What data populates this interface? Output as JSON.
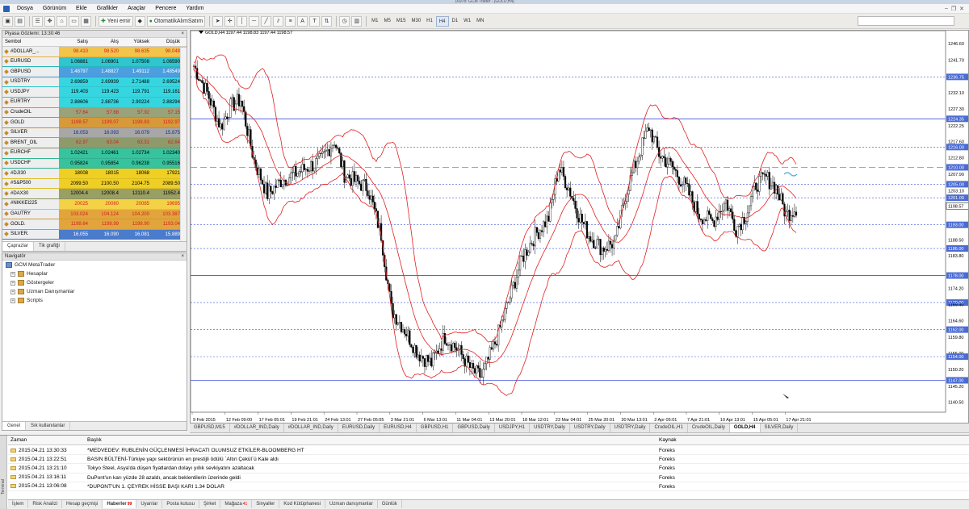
{
  "window": {
    "title": "16978: GCM Trader - [GOLD,H4]"
  },
  "menu": [
    "Dosya",
    "Görünüm",
    "Ekle",
    "Grafikler",
    "Araçlar",
    "Pencere",
    "Yardım"
  ],
  "toolbar": {
    "new_order_label": "Yeni emir",
    "autotrade_label": "OtomatikAlımSatım",
    "timeframes": [
      "M1",
      "M5",
      "M15",
      "M30",
      "H1",
      "H4",
      "D1",
      "W1",
      "MN"
    ],
    "active_timeframe": "H4"
  },
  "market_watch": {
    "title": "Piyasa Gözlemi: 13:30:46",
    "columns": [
      "Sembol",
      "Satış",
      "Alış",
      "Yüksek",
      "Düşük"
    ],
    "rows": [
      {
        "symbol": "#DOLLAR_...",
        "bid": "98.410",
        "ask": "98.520",
        "high": "98.635",
        "low": "98.048",
        "bg": "#f3c44a",
        "fg": "#d21f1f"
      },
      {
        "symbol": "EURUSD",
        "bid": "1.06881",
        "ask": "1.06901",
        "high": "1.07508",
        "low": "1.06590",
        "bg": "#2ec6cf",
        "fg": "#000000"
      },
      {
        "symbol": "GBPUSD",
        "bid": "1.48797",
        "ask": "1.48827",
        "high": "1.49112",
        "low": "1.48549",
        "bg": "#4b9ee0",
        "fg": "#ffffff"
      },
      {
        "symbol": "USDTRY",
        "bid": "2.69859",
        "ask": "2.69939",
        "high": "2.71488",
        "low": "2.69524",
        "bg": "#35d6e0",
        "fg": "#000000"
      },
      {
        "symbol": "USDJPY",
        "bid": "119.403",
        "ask": "119.423",
        "high": "119.791",
        "low": "119.161",
        "bg": "#35d6e0",
        "fg": "#000000"
      },
      {
        "symbol": "EURTRY",
        "bid": "2.88606",
        "ask": "2.88736",
        "high": "2.90224",
        "low": "2.88294",
        "bg": "#35d6e0",
        "fg": "#000000"
      },
      {
        "symbol": "CrudeOIL",
        "bid": "57.64",
        "ask": "57.68",
        "high": "57.92",
        "low": "57.15",
        "bg": "#9aa27a",
        "fg": "#d21f1f"
      },
      {
        "symbol": "GOLD",
        "bid": "1198.57",
        "ask": "1199.07",
        "high": "1198.83",
        "low": "1192.97",
        "bg": "#d79a3b",
        "fg": "#d21f1f"
      },
      {
        "symbol": "SILVER",
        "bid": "16.053",
        "ask": "16.093",
        "high": "16.079",
        "low": "15.875",
        "bg": "#a7a7a7",
        "fg": "#1c2a8c"
      },
      {
        "symbol": "BRENT_OIL",
        "bid": "62.97",
        "ask": "63.04",
        "high": "63.31",
        "low": "62.64",
        "bg": "#8f9a6c",
        "fg": "#d21f1f"
      },
      {
        "symbol": "EURCHF",
        "bid": "1.02421",
        "ask": "1.02461",
        "high": "1.02734",
        "low": "1.02340",
        "bg": "#36c39d",
        "fg": "#000000"
      },
      {
        "symbol": "USDCHF",
        "bid": "0.95824",
        "ask": "0.95854",
        "high": "0.96238",
        "low": "0.95516",
        "bg": "#36c39d",
        "fg": "#000000"
      },
      {
        "symbol": "#DJI30",
        "bid": "18008",
        "ask": "18015",
        "high": "18068",
        "low": "17921",
        "bg": "#f0cf24",
        "fg": "#000000"
      },
      {
        "symbol": "#S&P500",
        "bid": "2099.50",
        "ask": "2100.50",
        "high": "2104.75",
        "low": "2089.50",
        "bg": "#f0cf24",
        "fg": "#000000"
      },
      {
        "symbol": "#DAX30",
        "bid": "12004.4",
        "ask": "12008.4",
        "high": "12110.4",
        "low": "11952.4",
        "bg": "#9a9f63",
        "fg": "#000000"
      },
      {
        "symbol": "#NIKKEI225",
        "bid": "20025",
        "ask": "20060",
        "high": "20085",
        "low": "19695",
        "bg": "#f4d246",
        "fg": "#d21f1f"
      },
      {
        "symbol": "GAUTRY",
        "bid": "103.024",
        "ask": "104.124",
        "high": "104.200",
        "low": "103.387",
        "bg": "#e2a53c",
        "fg": "#d21f1f"
      },
      {
        "symbol": "GOLD.",
        "bid": "1198.64",
        "ask": "1198.99",
        "high": "1198.90",
        "low": "1193.04",
        "bg": "#e2a53c",
        "fg": "#d21f1f"
      },
      {
        "symbol": "SILVER.",
        "bid": "16.055",
        "ask": "16.090",
        "high": "16.081",
        "low": "15.889",
        "bg": "#4b7ccc",
        "fg": "#ffffff"
      }
    ],
    "tabs": [
      "Çaprazlar",
      "Tik grafiği"
    ]
  },
  "navigator": {
    "title": "Navigatör",
    "root": "GCM MetaTrader",
    "items": [
      "Hesaplar",
      "Göstergeler",
      "Uzman Danışmanlar",
      "Scripts"
    ],
    "tabs": [
      "Genel",
      "Sık kullanılanlar"
    ]
  },
  "chart": {
    "info_line": "GOLD,H4  1197.44 1198.83 1197.44 1198.57",
    "price_labels": [
      "1246.60",
      "1241.70",
      "1236.75",
      "1232.10",
      "1227.30",
      "1224.35",
      "1222.25",
      "1217.60",
      "1216.00",
      "1212.80",
      "1210.00",
      "1207.90",
      "1205.00",
      "1203.10",
      "1201.00",
      "1198.57",
      "1193.00",
      "1188.50",
      "1186.00",
      "1183.80",
      "1178.00",
      "1174.20",
      "1170.00",
      "1169.40",
      "1164.60",
      "1162.00",
      "1159.80",
      "1155.00",
      "1154.00",
      "1150.20",
      "1147.00",
      "1145.20",
      "1140.50"
    ],
    "time_labels": [
      "9 Feb 2015",
      "12 Feb 09:00",
      "17 Feb 05:01",
      "19 Feb 21:01",
      "24 Feb 13:01",
      "27 Feb 05:05",
      "3 Mar 21:01",
      "6 Mar 13:01",
      "11 Mar 04:01",
      "13 Mar 20:01",
      "18 Mar 12:01",
      "23 Mar 04:01",
      "25 Mar 20:01",
      "30 Mar 13:01",
      "2 Apr 05:01",
      "7 Apr 21:01",
      "10 Apr 13:01",
      "15 Apr 05:01",
      "17 Apr 21:01"
    ],
    "colors": {
      "candle": "#000000",
      "bands": "#e02020",
      "lines": "#3f51d8",
      "current": "#4a6bd4"
    },
    "tabs": [
      "GBPUSD,M15",
      "#DOLLAR_IND,Daily",
      "#DOLLAR_IND,Daily",
      "EURUSD,Daily",
      "EURUSD,H4",
      "GBPUSD,H1",
      "GBPUSD,Daily",
      "USDJPY,H1",
      "USDTRY,Daily",
      "USDTRY,Daily",
      "USDTRY,Daily",
      "CrudeOIL,H1",
      "CrudeOIL,Daily",
      "GOLD,H4",
      "SILVER,Daily"
    ],
    "active_tab": "GOLD,H4"
  },
  "terminal": {
    "side_label": "Terminal",
    "columns": [
      "Zaman",
      "Başlık",
      "Kaynak"
    ],
    "rows": [
      {
        "time": "2015.04.21 13:30:33",
        "title": "*MEDVEDEV: RUBLENİN GÜÇLENMESİ İHRACATI OLUMSUZ ETKİLER-BLOOMBERG HT",
        "source": "Foreks"
      },
      {
        "time": "2015.04.21 13:22:51",
        "title": "BASIN BÜLTENİ-Türkiye yapı sektörünün en prestijli ödülü `Altın Çekül`ü Kale aldı",
        "source": "Foreks"
      },
      {
        "time": "2015.04.21 13:21:10",
        "title": "Tokyo Steel, Asya'da düşen fiyatlardan dolayı yıllık sevkiyatını azaltacak",
        "source": "Foreks"
      },
      {
        "time": "2015.04.21 13:16:11",
        "title": "DuPont'un karı yüzde 28 azaldı, ancak beklentilerin üzerinde geldi",
        "source": "Foreks"
      },
      {
        "time": "2015.04.21 13:06:08",
        "title": "*DUPONT'UN 1. ÇEYREK HİSSE BAŞI KARI 1.34 DOLAR",
        "source": "Foreks"
      }
    ],
    "tabs": [
      {
        "label": "İşlem",
        "badge": ""
      },
      {
        "label": "Risk Analizi",
        "badge": ""
      },
      {
        "label": "Hesap geçmişi",
        "badge": ""
      },
      {
        "label": "Haberler",
        "badge": "99"
      },
      {
        "label": "Uyarılar",
        "badge": ""
      },
      {
        "label": "Posta kutusu",
        "badge": ""
      },
      {
        "label": "Şirket",
        "badge": ""
      },
      {
        "label": "Mağaza",
        "badge": "41"
      },
      {
        "label": "Sinyaller",
        "badge": ""
      },
      {
        "label": "Kod Kütüphanesi",
        "badge": ""
      },
      {
        "label": "Uzman danışmanlar",
        "badge": ""
      },
      {
        "label": "Günlük",
        "badge": ""
      }
    ],
    "active_tab": "Haberler"
  }
}
